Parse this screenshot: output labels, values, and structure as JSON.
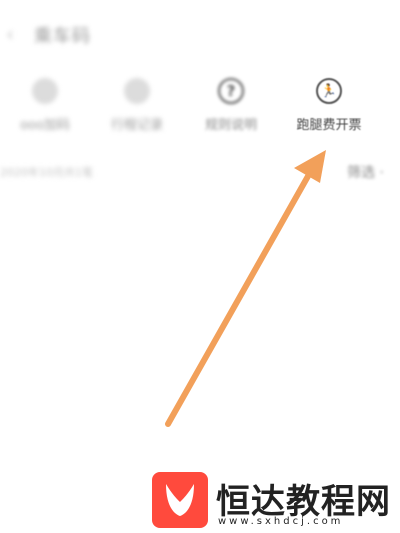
{
  "header": {
    "title": "乘车码",
    "back_icon": "chevron-left-icon"
  },
  "quick_actions": [
    {
      "label": "ooo加码",
      "icon": "blurred-icon"
    },
    {
      "label": "行程记录",
      "icon": "blurred-icon"
    },
    {
      "label": "规则说明",
      "icon": "question-circle-icon",
      "glyph": "?"
    },
    {
      "label": "跑腿费开票",
      "icon": "runner-circle-icon",
      "glyph": "🏃"
    }
  ],
  "list": {
    "summary": "2020年10月共1笔",
    "filter_label": "筛选 ·"
  },
  "annotation": {
    "arrow_color": "#f2a05a"
  },
  "watermark": {
    "name": "恒达教程网",
    "url": "www.sxhdcj.com",
    "brand_color": "#ff4a3d"
  }
}
